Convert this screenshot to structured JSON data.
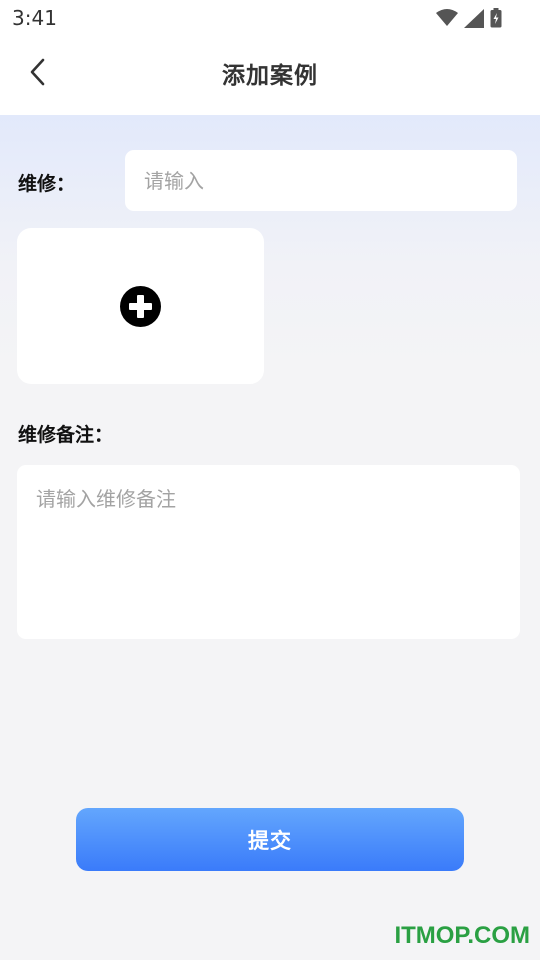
{
  "status_bar": {
    "time": "3:41",
    "icons": [
      "wifi-icon",
      "cellular-signal-icon",
      "battery-charging-icon"
    ]
  },
  "app_bar": {
    "back_icon": "chevron-left-icon",
    "title": "添加案例"
  },
  "form": {
    "repair_label": "维修：",
    "repair_placeholder": "请输入",
    "repair_value": "",
    "upload_icon": "plus-circle-icon",
    "remark_label": "维修备注：",
    "remark_placeholder": "请输入维修备注",
    "remark_value": ""
  },
  "submit_label": "提交",
  "watermark": "ITMOP.COM",
  "colors": {
    "primary_gradient_top": "#63a6fd",
    "primary_gradient_bottom": "#3a7bfa",
    "watermark_green": "#2aa043",
    "background": "#f4f4f6",
    "header_tint": "#e2e9fb"
  }
}
